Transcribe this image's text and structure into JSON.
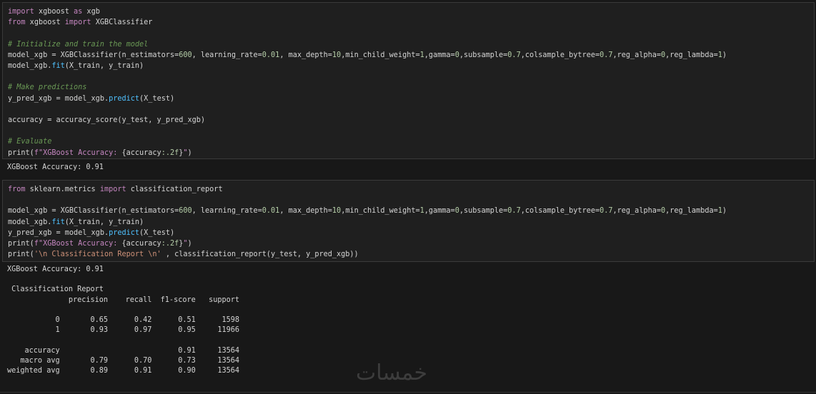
{
  "cells": [
    {
      "lines": [
        [
          [
            "import",
            "kw"
          ],
          [
            " xgboost ",
            "op"
          ],
          [
            "as",
            "kw"
          ],
          [
            " xgb",
            "op"
          ]
        ],
        [
          [
            "from",
            "kw"
          ],
          [
            " xgboost ",
            "op"
          ],
          [
            "import",
            "kw"
          ],
          [
            " XGBClassifier",
            "op"
          ]
        ],
        [
          [
            "",
            ""
          ]
        ],
        [
          [
            "# Initialize and train the model",
            "cm"
          ]
        ],
        [
          [
            "model_xgb",
            "op"
          ],
          [
            " = ",
            "op"
          ],
          [
            "XGBClassifier",
            "op"
          ],
          [
            "(n_estimators=",
            "op"
          ],
          [
            "600",
            "num"
          ],
          [
            ", learning_rate=",
            "op"
          ],
          [
            "0.01",
            "num"
          ],
          [
            ", max_depth=",
            "op"
          ],
          [
            "10",
            "num"
          ],
          [
            ",min_child_weight=",
            "op"
          ],
          [
            "1",
            "num"
          ],
          [
            ",gamma=",
            "op"
          ],
          [
            "0",
            "num"
          ],
          [
            ",subsample=",
            "op"
          ],
          [
            "0.7",
            "num"
          ],
          [
            ",colsample_bytree=",
            "op"
          ],
          [
            "0.7",
            "num"
          ],
          [
            ",reg_alpha=",
            "op"
          ],
          [
            "0",
            "num"
          ],
          [
            ",reg_lambda=",
            "op"
          ],
          [
            "1",
            "num"
          ],
          [
            ")",
            "op"
          ]
        ],
        [
          [
            "model_xgb.",
            "op"
          ],
          [
            "fit",
            "m"
          ],
          [
            "(X_train, y_train)",
            "op"
          ]
        ],
        [
          [
            "",
            ""
          ]
        ],
        [
          [
            "# Make predictions",
            "cm"
          ]
        ],
        [
          [
            "y_pred_xgb",
            "op"
          ],
          [
            " = ",
            "op"
          ],
          [
            "model_xgb.",
            "op"
          ],
          [
            "predict",
            "m"
          ],
          [
            "(X_test)",
            "op"
          ]
        ],
        [
          [
            "",
            ""
          ]
        ],
        [
          [
            "accuracy",
            "op"
          ],
          [
            " = ",
            "op"
          ],
          [
            "accuracy_score(y_test, y_pred_xgb)",
            "op"
          ]
        ],
        [
          [
            "",
            ""
          ]
        ],
        [
          [
            "# Evaluate",
            "cm"
          ]
        ],
        [
          [
            "print(",
            "op"
          ],
          [
            "f\"XGBoost Accuracy: ",
            "fstr"
          ],
          [
            "{accuracy",
            "op"
          ],
          [
            ":.2f",
            "num"
          ],
          [
            "}",
            "op"
          ],
          [
            "\"",
            "fstr"
          ],
          [
            ")",
            "op"
          ]
        ]
      ],
      "output": "XGBoost Accuracy: 0.91"
    },
    {
      "lines": [
        [
          [
            "from",
            "kw"
          ],
          [
            " sklearn.metrics ",
            "op"
          ],
          [
            "import",
            "kw"
          ],
          [
            " classification_report",
            "op"
          ]
        ],
        [
          [
            "",
            ""
          ]
        ],
        [
          [
            "model_xgb",
            "op"
          ],
          [
            " = ",
            "op"
          ],
          [
            "XGBClassifier",
            "op"
          ],
          [
            "(n_estimators=",
            "op"
          ],
          [
            "600",
            "num"
          ],
          [
            ", learning_rate=",
            "op"
          ],
          [
            "0.01",
            "num"
          ],
          [
            ", max_depth=",
            "op"
          ],
          [
            "10",
            "num"
          ],
          [
            ",min_child_weight=",
            "op"
          ],
          [
            "1",
            "num"
          ],
          [
            ",gamma=",
            "op"
          ],
          [
            "0",
            "num"
          ],
          [
            ",subsample=",
            "op"
          ],
          [
            "0.7",
            "num"
          ],
          [
            ",colsample_bytree=",
            "op"
          ],
          [
            "0.7",
            "num"
          ],
          [
            ",reg_alpha=",
            "op"
          ],
          [
            "0",
            "num"
          ],
          [
            ",reg_lambda=",
            "op"
          ],
          [
            "1",
            "num"
          ],
          [
            ")",
            "op"
          ]
        ],
        [
          [
            "model_xgb.",
            "op"
          ],
          [
            "fit",
            "m"
          ],
          [
            "(X_train, y_train)",
            "op"
          ]
        ],
        [
          [
            "y_pred_xgb",
            "op"
          ],
          [
            " = ",
            "op"
          ],
          [
            "model_xgb.",
            "op"
          ],
          [
            "predict",
            "m"
          ],
          [
            "(X_test)",
            "op"
          ]
        ],
        [
          [
            "print(",
            "op"
          ],
          [
            "f\"XGBoost Accuracy: ",
            "fstr"
          ],
          [
            "{accuracy",
            "op"
          ],
          [
            ":.2f",
            "num"
          ],
          [
            "}",
            "op"
          ],
          [
            "\"",
            "fstr"
          ],
          [
            ")",
            "op"
          ]
        ],
        [
          [
            "print(",
            "op"
          ],
          [
            "'\\n Classification Report \\n'",
            "str"
          ],
          [
            " , classification_report(y_test, y_pred_xgb))",
            "op"
          ]
        ]
      ],
      "output": "XGBoost Accuracy: 0.91\n\n Classification Report\n              precision    recall  f1-score   support\n\n           0       0.65      0.42      0.51      1598\n           1       0.93      0.97      0.95     11966\n\n    accuracy                           0.91     13564\n   macro avg       0.79      0.70      0.73     13564\nweighted avg       0.89      0.91      0.90     13564"
    }
  ],
  "watermark": "خمسات"
}
